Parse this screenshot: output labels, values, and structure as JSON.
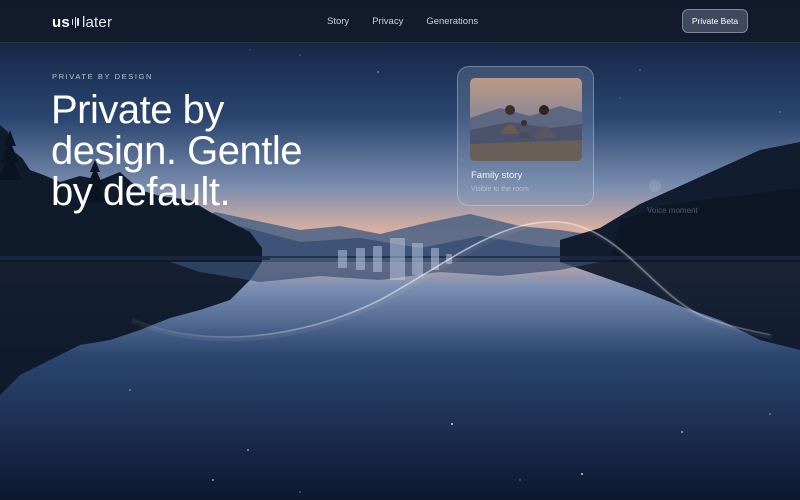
{
  "brand": {
    "logo_left": "us",
    "logo_right": "later"
  },
  "nav": {
    "links": [
      "Story",
      "Privacy",
      "Generations"
    ],
    "cta_label": "Private Beta"
  },
  "hero": {
    "eyebrow": "PRIVATE BY DESIGN",
    "headline": "Private by design. Gentle by default."
  },
  "cards": {
    "family": {
      "title": "Family story",
      "subtitle": "Visible to the room"
    },
    "voice": {
      "label": "Voice moment"
    }
  },
  "colors": {
    "sky_top": "#0b1830",
    "sky_mid": "#3d5d8a",
    "horizon": "#e7b9a3",
    "water": "#0c1a33",
    "cta_bg": "#465266"
  }
}
